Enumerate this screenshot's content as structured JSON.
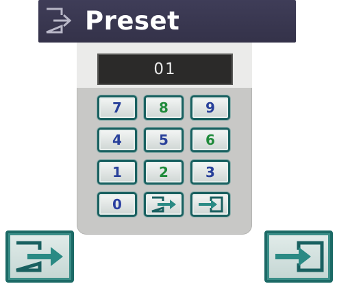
{
  "dialog": {
    "title": "Preset",
    "title_icon": "exit-arrow-icon",
    "display_value": "01"
  },
  "keypad": {
    "rows": [
      [
        "7",
        "8",
        "9"
      ],
      [
        "4",
        "5",
        "6"
      ],
      [
        "1",
        "2",
        "3"
      ]
    ],
    "zero": "0",
    "exit_icon": "exit-arrow-icon",
    "enter_icon": "enter-arrow-icon"
  },
  "corner_buttons": {
    "left_icon": "exit-arrow-icon",
    "right_icon": "enter-arrow-icon"
  },
  "colors": {
    "title_bar": "#3a3852",
    "panel": "#c8c8c6",
    "key_border": "#196060",
    "digit_blue": "#28409a",
    "digit_green": "#1f8a3a",
    "arrow_teal": "#2a8a84"
  }
}
